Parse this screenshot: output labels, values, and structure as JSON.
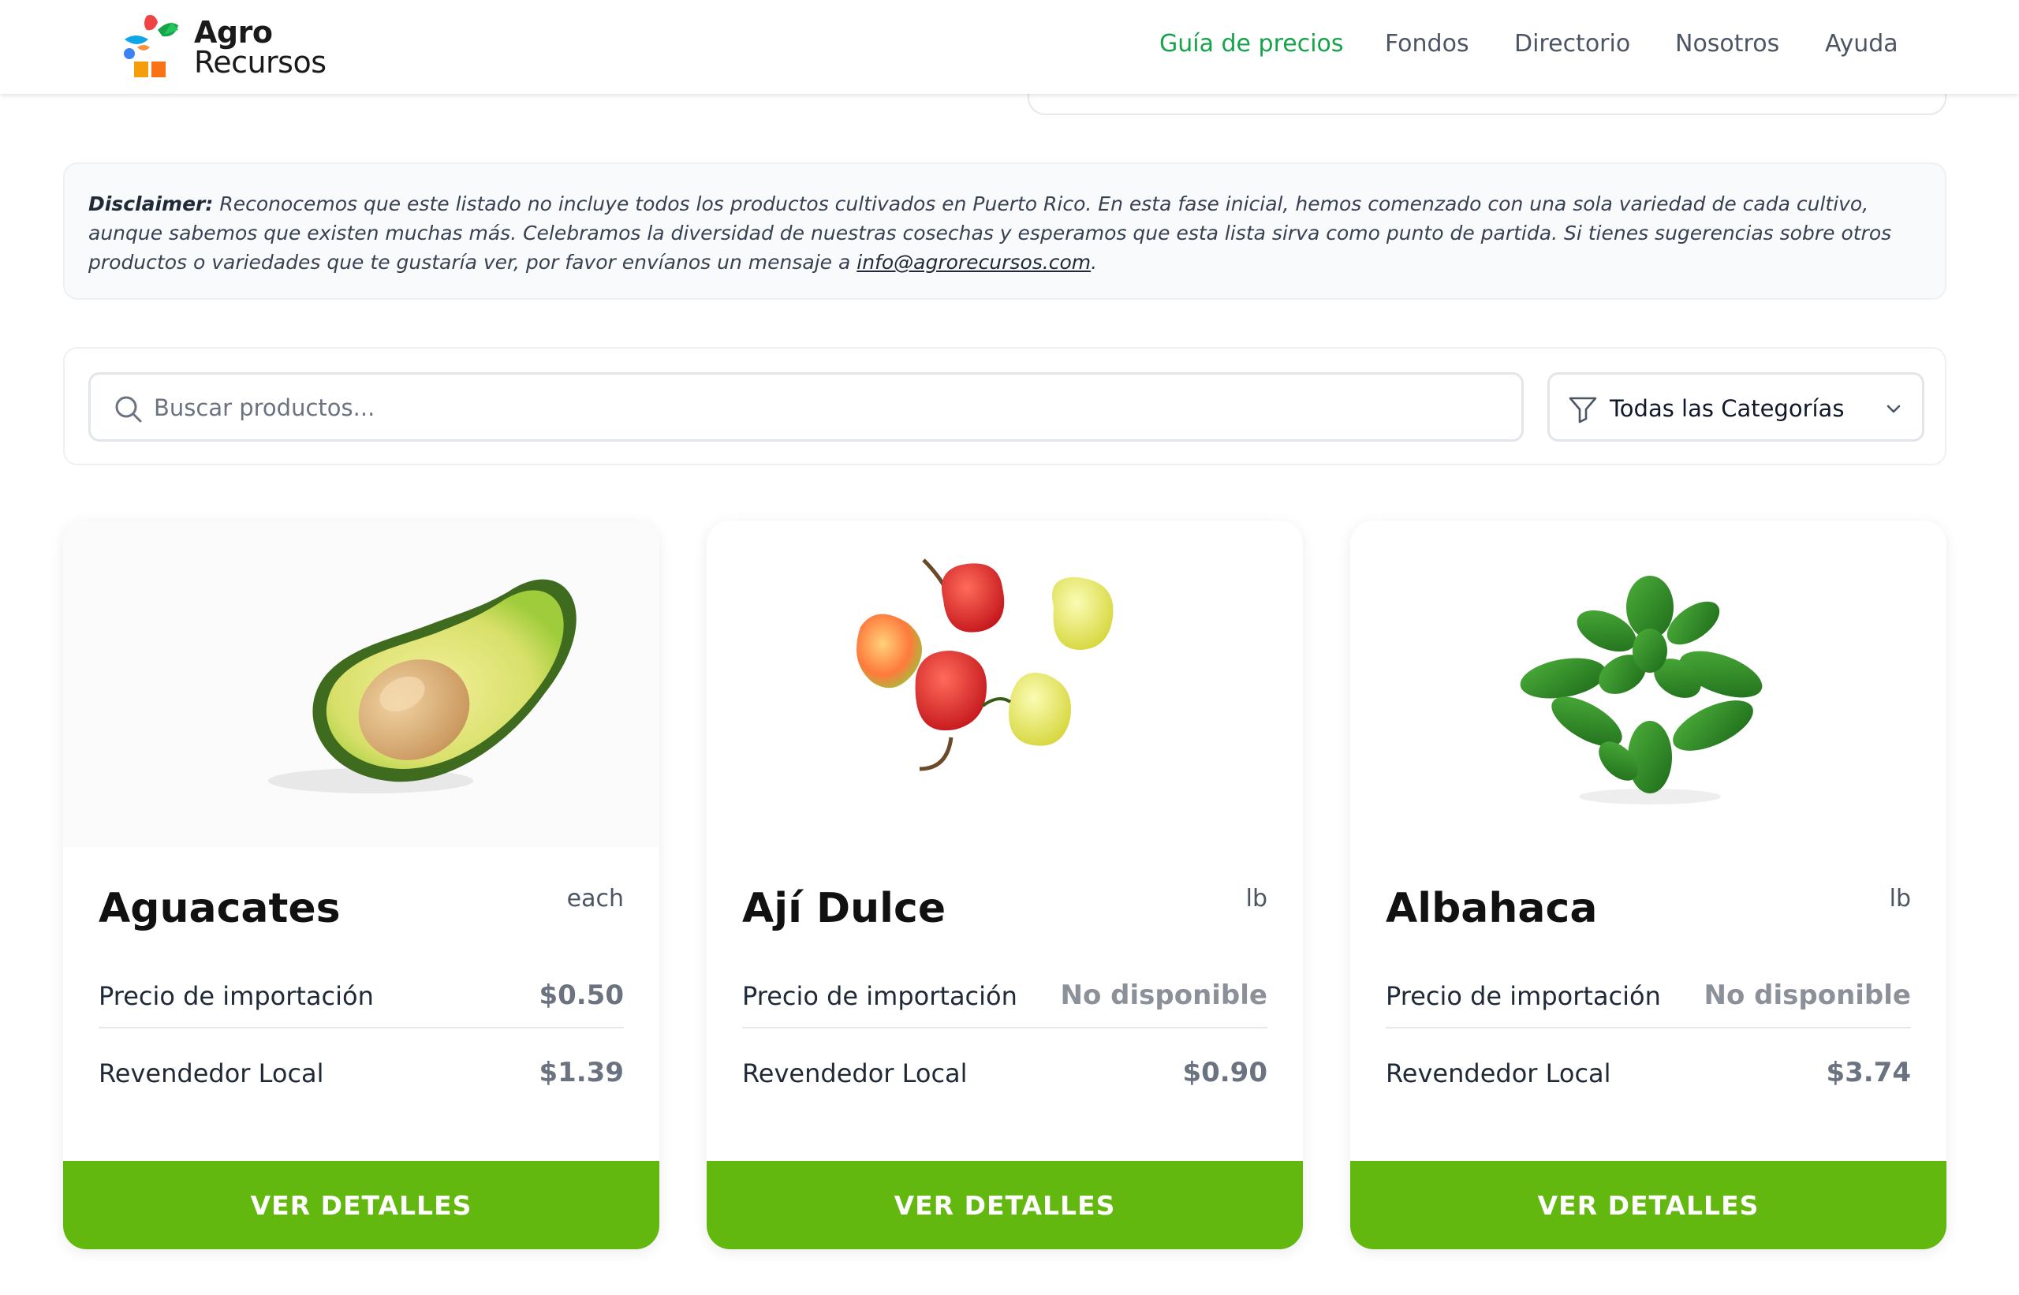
{
  "header": {
    "logo": {
      "line1": "Agro",
      "line2": "Recursos"
    },
    "nav": [
      {
        "label": "Guía de precios",
        "active": true
      },
      {
        "label": "Fondos",
        "active": false
      },
      {
        "label": "Directorio",
        "active": false
      },
      {
        "label": "Nosotros",
        "active": false
      },
      {
        "label": "Ayuda",
        "active": false
      }
    ]
  },
  "disclaimer": {
    "title": "Disclaimer:",
    "text": "Reconocemos que este listado no incluye todos los productos cultivados en Puerto Rico. En esta fase inicial, hemos comenzado con una sola variedad de cada cultivo, aunque sabemos que existen muchas más. Celebramos la diversidad de nuestras cosechas y esperamos que esta lista sirva como punto de partida. Si tienes sugerencias sobre otros productos o variedades que te gustaría ver, por favor envíanos un mensaje a",
    "email": "info@agrorecursos.com",
    "end": "."
  },
  "search": {
    "placeholder": "Buscar productos...",
    "value": "",
    "category_selected": "Todas las Categorías"
  },
  "products": [
    {
      "name": "Aguacates",
      "unit": "each",
      "import_label": "Precio de importación",
      "import_price": "$0.50",
      "local_label": "Revendedor Local",
      "local_price": "$1.39",
      "button": "VER DETALLES"
    },
    {
      "name": "Ají Dulce",
      "unit": "lb",
      "import_label": "Precio de importación",
      "import_price": "No disponible",
      "local_label": "Revendedor Local",
      "local_price": "$0.90",
      "button": "VER DETALLES"
    },
    {
      "name": "Albahaca",
      "unit": "lb",
      "import_label": "Precio de importación",
      "import_price": "No disponible",
      "local_label": "Revendedor Local",
      "local_price": "$3.74",
      "button": "VER DETALLES"
    }
  ],
  "colors": {
    "brand_green": "#16a34a",
    "button_green": "#62b80f"
  }
}
